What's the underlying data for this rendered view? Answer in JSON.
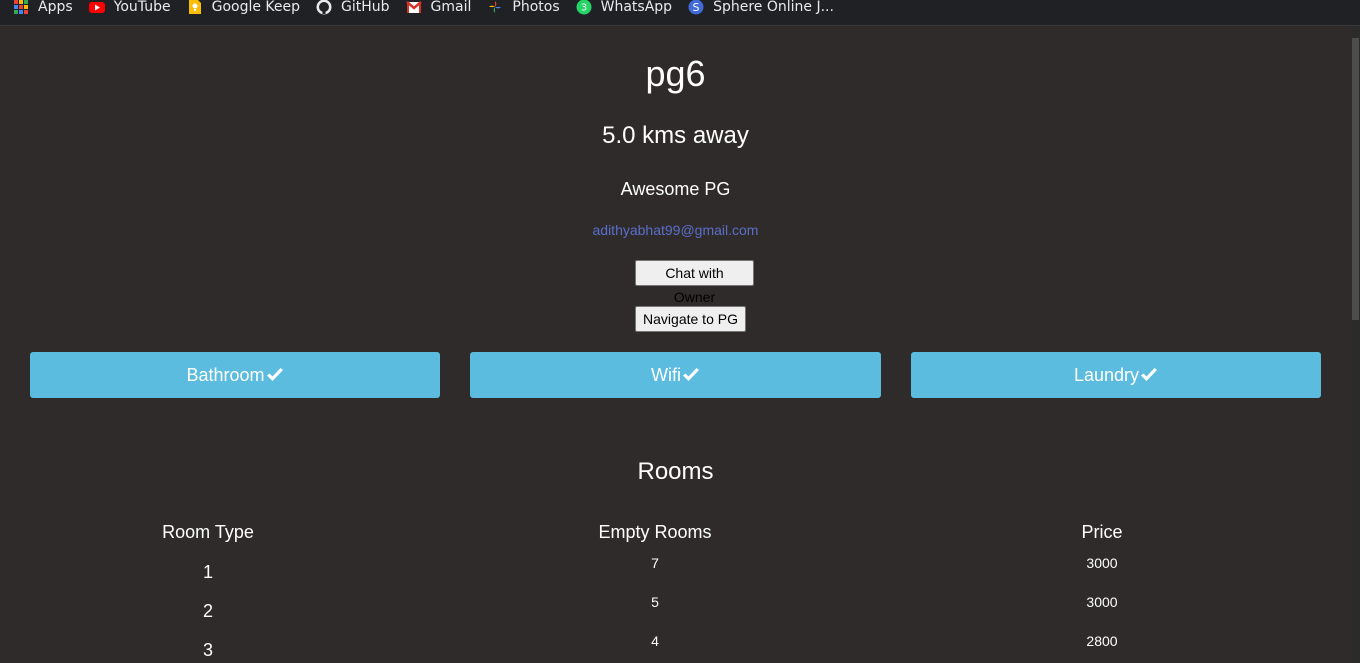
{
  "bookmarks": [
    {
      "label": "Apps",
      "icon": "apps-grid-icon"
    },
    {
      "label": "YouTube",
      "icon": "youtube-icon"
    },
    {
      "label": "Google Keep",
      "icon": "google-keep-icon"
    },
    {
      "label": "GitHub",
      "icon": "github-icon"
    },
    {
      "label": "Gmail",
      "icon": "gmail-icon"
    },
    {
      "label": "Photos",
      "icon": "photos-icon"
    },
    {
      "label": "WhatsApp",
      "icon": "whatsapp-icon"
    },
    {
      "label": "Sphere Online J...",
      "icon": "sphere-online-judge-icon"
    }
  ],
  "pg": {
    "name": "pg6",
    "distance": "5.0 kms away",
    "description": "Awesome PG",
    "email": "adithyabhat99@gmail.com"
  },
  "actions": {
    "chat_label": "Chat with Owner",
    "navigate_label": "Navigate to PG"
  },
  "amenities": [
    {
      "label": "Bathroom",
      "icon": "checkmark-icon"
    },
    {
      "label": "Wifi",
      "icon": "checkmark-icon"
    },
    {
      "label": "Laundry",
      "icon": "checkmark-icon"
    }
  ],
  "rooms": {
    "heading": "Rooms",
    "columns": [
      "Room Type",
      "Empty Rooms",
      "Price"
    ],
    "rows": [
      {
        "type": "1",
        "empty": "7",
        "price": "3000"
      },
      {
        "type": "2",
        "empty": "5",
        "price": "3000"
      },
      {
        "type": "3",
        "empty": "4",
        "price": "2800"
      }
    ]
  },
  "colors": {
    "background": "#2f2b2b",
    "amenity_bg": "#5bbce0",
    "email_link": "#5b6fc9"
  }
}
